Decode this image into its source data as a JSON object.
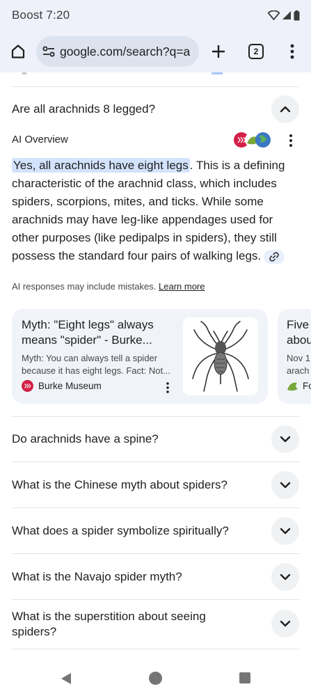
{
  "status": {
    "carrier_time": "Boost 7:20"
  },
  "browser": {
    "url": "google.com/search?q=a",
    "tab_count": "2"
  },
  "faq": {
    "expanded_question": "Are all arachnids 8 legged?",
    "ai_overview": {
      "label": "AI Overview",
      "highlight": "Yes, all arachnids have eight legs",
      "body": ". This is a defining characteristic of the arachnid class, which includes spiders, scorpions, mites, and ticks. While some arachnids may have leg-like appendages used for other purposes (like pedipalps in spiders), they still possess the standard four pairs of walking legs.",
      "disclaimer": "AI responses may include mistakes.",
      "learn_more": "Learn more"
    },
    "cards": [
      {
        "title": "Myth: \"Eight legs\" always means \"spider\" - Burke...",
        "snippet": "Myth: You can always tell a spider because it has eight legs. Fact: Not...",
        "source": "Burke Museum"
      },
      {
        "title": "Five\nabou",
        "snippet": "Nov 1,\narach",
        "source": "Fo"
      }
    ],
    "questions": [
      "Do arachnids have a spine?",
      "What is the Chinese myth about spiders?",
      "What does a spider symbolize spiritually?",
      "What is the Navajo spider myth?",
      "What is the superstition about seeing spiders?"
    ]
  },
  "colors": {
    "highlight": "#d3e3fd",
    "toolbar_bg": "#eef1f9",
    "card_bg": "#f0f4f9",
    "burke_red": "#d21f46"
  }
}
